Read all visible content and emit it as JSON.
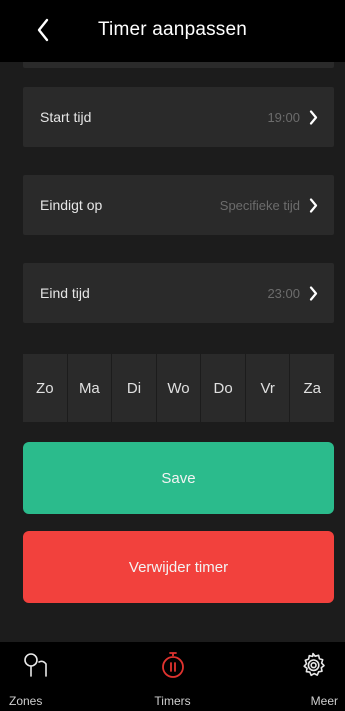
{
  "header": {
    "title": "Timer aanpassen",
    "back_icon": "chevron-left-icon"
  },
  "rows": [
    {
      "label": "Start tijd",
      "value": "19:00"
    },
    {
      "label": "Eindigt op",
      "value": "Specifieke tijd"
    },
    {
      "label": "Eind tijd",
      "value": "23:00"
    }
  ],
  "days": [
    "Zo",
    "Ma",
    "Di",
    "Wo",
    "Do",
    "Vr",
    "Za"
  ],
  "buttons": {
    "save": "Save",
    "delete": "Verwijder timer"
  },
  "tabs": [
    {
      "label": "Zones",
      "icon": "zones-pin-icon",
      "active": false
    },
    {
      "label": "Timers",
      "icon": "timer-icon",
      "active": true
    },
    {
      "label": "Meer",
      "icon": "gear-icon",
      "active": false
    }
  ],
  "colors": {
    "save": "#2bbb8c",
    "delete": "#f2413d",
    "active_tab": "#e0332f"
  }
}
